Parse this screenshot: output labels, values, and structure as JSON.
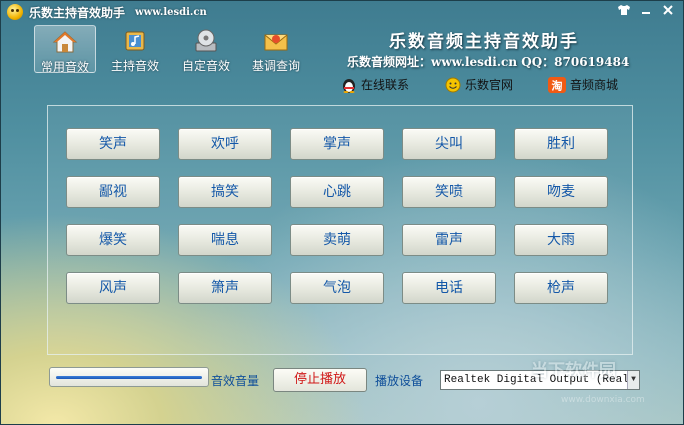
{
  "window": {
    "title": "乐数主持音效助手",
    "title_url": "www.lesdi.cn",
    "controls": [
      "skin",
      "minimize",
      "close"
    ]
  },
  "toolbar": {
    "items": [
      {
        "label": "常用音效",
        "icon": "house-icon",
        "active": true
      },
      {
        "label": "主持音效",
        "icon": "music-book-icon",
        "active": false
      },
      {
        "label": "自定音效",
        "icon": "cd-drive-icon",
        "active": false
      },
      {
        "label": "基调查询",
        "icon": "envelope-icon",
        "active": false
      }
    ]
  },
  "brand": {
    "title": "乐数音频主持音效助手",
    "url_line": "乐数音频网址：www.lesdi.cn QQ：870619484"
  },
  "links": [
    {
      "label": "在线联系",
      "icon": "qq-penguin-icon"
    },
    {
      "label": "乐数官网",
      "icon": "smiley-icon"
    },
    {
      "label": "音频商城",
      "icon": "taobao-icon"
    }
  ],
  "sounds": [
    [
      "笑声",
      "欢呼",
      "掌声",
      "尖叫",
      "胜利"
    ],
    [
      "鄙视",
      "搞笑",
      "心跳",
      "笑喷",
      "吻麦"
    ],
    [
      "爆笑",
      "喘息",
      "卖萌",
      "雷声",
      "大雨"
    ],
    [
      "风声",
      "箫声",
      "气泡",
      "电话",
      "枪声"
    ]
  ],
  "bottom": {
    "volume_label": "音效音量",
    "stop_label": "停止播放",
    "device_label": "播放设备",
    "device_value": "Realtek Digital Output (Realte"
  },
  "watermark": {
    "text": "当下软件园",
    "sub": "www.downxia.com"
  },
  "colors": {
    "sound_text": "#1458a8",
    "stop_text": "#d01818",
    "label_blue": "#0f4f9a"
  }
}
